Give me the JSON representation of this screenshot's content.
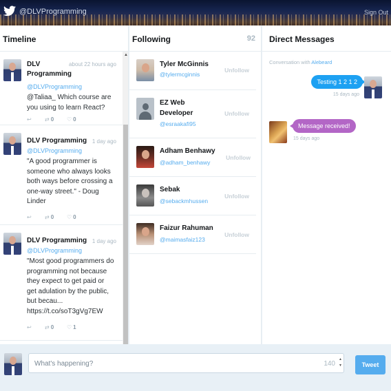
{
  "header": {
    "handle": "@DLVProgramming",
    "signout": "Sign Out",
    "logo_icon": "twitter-bird-icon"
  },
  "timeline": {
    "title": "Timeline",
    "tweets": [
      {
        "name": "DLV Programming",
        "time": "about 22 hours ago",
        "handle": "@DLVProgramming",
        "text": "@Taliaa_ Which course are you using to learn React?",
        "retweets": "0",
        "likes": "0"
      },
      {
        "name": "DLV Programming",
        "time": "1 day ago",
        "handle": "@DLVProgramming",
        "text": "\"A good programmer is someone who always looks both ways before crossing a one-way street.\" - Doug Linder",
        "retweets": "0",
        "likes": "0"
      },
      {
        "name": "DLV Programming",
        "time": "1 day ago",
        "handle": "@DLVProgramming",
        "text": "\"Most good programmers do programming not because they expect to get paid or get adulation by the public, but becau... https://t.co/soT3gVg7EW",
        "retweets": "0",
        "likes": "1"
      }
    ]
  },
  "following": {
    "title": "Following",
    "count": "92",
    "unfollow_label": "Unfollow",
    "users": [
      {
        "name": "Tyler McGinnis",
        "handle": "@tylermcginnis"
      },
      {
        "name": "EZ Web Developer",
        "handle": "@esraakafi95"
      },
      {
        "name": "Adham Benhawy",
        "handle": "@adham_benhawy"
      },
      {
        "name": "Sebak",
        "handle": "@sebackmhussen"
      },
      {
        "name": "Faizur Rahuman",
        "handle": "@maimasfaiz123"
      }
    ]
  },
  "dms": {
    "title": "Direct Messages",
    "conversation_prefix": "Conversation with",
    "conversation_with": "Alebeard",
    "messages": [
      {
        "text": "Testing 1 2 1 2",
        "time": "15 days ago",
        "direction": "outgoing"
      },
      {
        "text": "Message received!",
        "time": "15 days ago",
        "direction": "incoming"
      }
    ]
  },
  "composer": {
    "placeholder": "What's happening?",
    "remaining": "140",
    "button": "Tweet"
  },
  "colors": {
    "accent": "#55acee",
    "outgoing_bubble": "#1da1f2",
    "incoming_bubble": "#b366c6"
  }
}
